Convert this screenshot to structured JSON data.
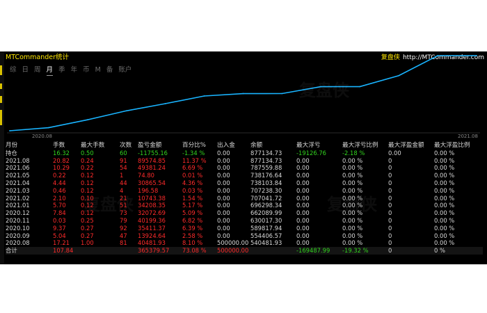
{
  "window": {
    "title": "MTCommander统计",
    "brand_name": "复盘侠",
    "brand_url": "http://MTCommander.com"
  },
  "period_tabs": [
    "综",
    "日",
    "周",
    "月",
    "季",
    "年",
    "币",
    "M",
    "备",
    "账户"
  ],
  "active_tab": "月",
  "chart_data": {
    "type": "line",
    "x_labels": [
      "2020.08",
      "2021.08"
    ],
    "x": [
      "2020.08",
      "2020.09",
      "2020.10",
      "2020.11",
      "2020.12",
      "2021.01",
      "2021.02",
      "2021.03",
      "2021.04",
      "2021.05",
      "2021.06",
      "2021.07",
      "2021.08"
    ],
    "y": [
      540481.93,
      554406.57,
      589817.94,
      630017.3,
      662089.99,
      696298.34,
      707041.72,
      707238.3,
      738103.84,
      738176.64,
      787559.88,
      877134.73,
      877134.73
    ],
    "series_color": "#19b4ff",
    "grid": false
  },
  "table": {
    "headers": [
      "月份",
      "手数",
      "最大手数",
      "次数",
      "盈亏金额",
      "百分比%",
      "出入金",
      "余额",
      "最大浮亏",
      "最大浮亏比例",
      "最大浮盈金额",
      "最大浮盈比例"
    ],
    "holding": [
      "持仓",
      "16.32",
      "0.50",
      "60",
      "-11755.16",
      "-1.34 %",
      "0.00",
      "877134.73",
      "-19126.76",
      "-2.18 %",
      "0.00",
      "0.00 %"
    ],
    "rows": [
      [
        "2021.08",
        "20.82",
        "0.24",
        "91",
        "89574.85",
        "11.37 %",
        "0.00",
        "877134.73",
        "0.00",
        "0.00 %",
        "0",
        "0.00 %"
      ],
      [
        "2021.06",
        "10.29",
        "0.22",
        "54",
        "49381.24",
        "6.69 %",
        "0.00",
        "787559.88",
        "0.00",
        "0.00 %",
        "0",
        "0.00 %"
      ],
      [
        "2021.05",
        "0.22",
        "0.12",
        "1",
        "74.80",
        "0.01 %",
        "0.00",
        "738176.64",
        "0.00",
        "0.00 %",
        "0",
        "0.00 %"
      ],
      [
        "2021.04",
        "4.44",
        "0.12",
        "44",
        "30865.54",
        "4.36 %",
        "0.00",
        "738103.84",
        "0.00",
        "0.00 %",
        "0",
        "0.00 %"
      ],
      [
        "2021.03",
        "0.46",
        "0.12",
        "4",
        "196.58",
        "0.03 %",
        "0.00",
        "707238.30",
        "0.00",
        "0.00 %",
        "0",
        "0.00 %"
      ],
      [
        "2021.02",
        "2.10",
        "0.10",
        "21",
        "10743.38",
        "1.54 %",
        "0.00",
        "707041.72",
        "0.00",
        "0.00 %",
        "0",
        "0.00 %"
      ],
      [
        "2021.01",
        "5.70",
        "0.12",
        "51",
        "34208.35",
        "5.17 %",
        "0.00",
        "696298.34",
        "0.00",
        "0.00 %",
        "0",
        "0.00 %"
      ],
      [
        "2020.12",
        "7.84",
        "0.12",
        "73",
        "32072.69",
        "5.09 %",
        "0.00",
        "662089.99",
        "0.00",
        "0.00 %",
        "0",
        "0.00 %"
      ],
      [
        "2020.11",
        "0.03",
        "0.25",
        "79",
        "40199.36",
        "6.82 %",
        "0.00",
        "630017.30",
        "0.00",
        "0.00 %",
        "0",
        "0.00 %"
      ],
      [
        "2020.10",
        "9.37",
        "0.27",
        "92",
        "35411.37",
        "6.39 %",
        "0.00",
        "589817.94",
        "0.00",
        "0.00 %",
        "0",
        "0.00 %"
      ],
      [
        "2020.09",
        "5.04",
        "0.27",
        "47",
        "13924.64",
        "2.58 %",
        "0.00",
        "554406.57",
        "0.00",
        "0.00 %",
        "0",
        "0.00 %"
      ],
      [
        "2020.08",
        "17.21",
        "1.00",
        "81",
        "40481.93",
        "8.10 %",
        "500000.00",
        "540481.93",
        "0.00",
        "0.00 %",
        "0",
        "0.00 %"
      ]
    ],
    "total": [
      "合计",
      "107.84",
      "",
      "",
      "365379.57",
      "73.08 %",
      "500000.00",
      "",
      "-169487.99",
      "-19.32 %",
      "0",
      "0 %"
    ]
  },
  "watermark": "复盘侠"
}
